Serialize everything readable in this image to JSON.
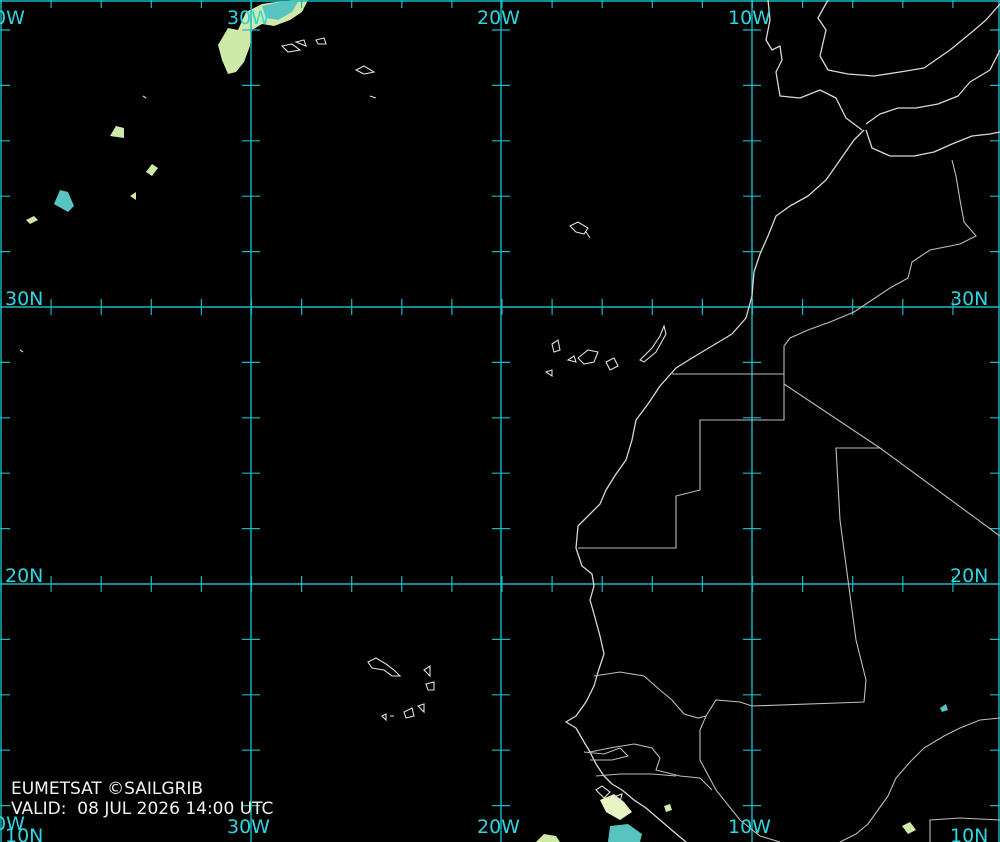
{
  "map": {
    "grid": {
      "longitudes": [
        {
          "name": "lon-30w",
          "label": "30W"
        },
        {
          "name": "lon-20w",
          "label": "20W"
        },
        {
          "name": "lon-10w",
          "label": "10W"
        }
      ],
      "latitudes": [
        {
          "name": "lat-30n",
          "label": "30N"
        },
        {
          "name": "lat-20n",
          "label": "20N"
        }
      ],
      "edge_labels": {
        "top_left_partial": "0W",
        "bottom_left_partial": "10N",
        "bottom_left_overlap": "0W",
        "bottom_right": "10N"
      },
      "line_color": "#19b9c4",
      "label_color": "#2fd6e0"
    },
    "colors": {
      "background": "#000000",
      "coastline": "#d8d8d8",
      "cloud_light": "#cfe9a8",
      "cloud_cyan": "#58c4c0"
    }
  },
  "credit": {
    "source": "EUMETSAT ©SAILGRIB",
    "valid": "VALID:  08 JUL 2026 14:00 UTC"
  }
}
